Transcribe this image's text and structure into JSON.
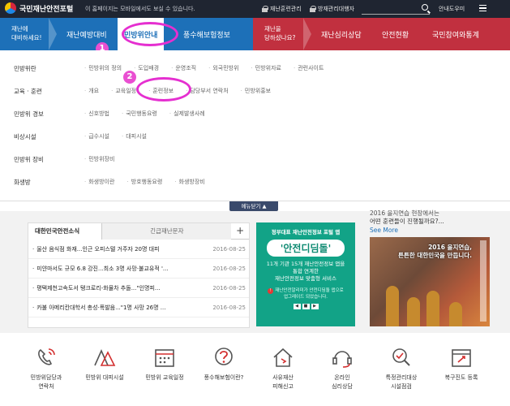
{
  "topbar": {
    "logo_text": "국민재난안전포털",
    "notice": "이 홈페이지는 모바일에서도 보실 수 있습니다.",
    "link1": "재난훈련관리",
    "link2": "방재관리대행자",
    "guide": "안내도우미",
    "search_placeholder": ""
  },
  "nav": {
    "left_label": "재난에\n대비하세요!",
    "blue_items": [
      "재난예방대비",
      "민방위안내",
      "풍수해보험정보"
    ],
    "right_label": "재난을\n당하셨나요?",
    "red_items": [
      "재난심리상담",
      "안전현황",
      "국민참여와통계"
    ],
    "active_index": 1
  },
  "megamenu": {
    "rows": [
      {
        "category": "민방위란",
        "links": [
          "민방위의 정의",
          "도입배경",
          "운영조직",
          "외국민방위",
          "민방위자료",
          "관련사이트"
        ]
      },
      {
        "category": "교육 · 훈련",
        "links": [
          "개요",
          "교육일정",
          "훈련정보",
          "담당부서 연락처",
          "민방위홍보"
        ]
      },
      {
        "category": "민방위 경보",
        "links": [
          "신호방법",
          "국민행동요령",
          "실제발생사례"
        ]
      },
      {
        "category": "비상시설",
        "links": [
          "급수시설",
          "대피시설"
        ]
      },
      {
        "category": "민방위 장비",
        "links": [
          "민방위장비"
        ]
      },
      {
        "category": "화생방",
        "links": [
          "화생방이란",
          "방호행동요령",
          "화생방장비"
        ]
      }
    ],
    "collapse_label": "메뉴닫기 ▲"
  },
  "badges": {
    "one": "1",
    "two": "2"
  },
  "news": {
    "tab_active": "대한민국안전소식",
    "tab_inactive": "긴급재난문자",
    "plus": "+",
    "items": [
      {
        "title": "울산 음식점 화재...인근 오피스텔 거주자 20명 대피",
        "date": "2016-08-25"
      },
      {
        "title": "미얀마서도 규모 6.8 강진...최소 3명 사망·불교유적 '...",
        "date": "2016-08-25"
      },
      {
        "title": "평택제천고속도서 탱크로리-화물차 추돌...\"인명피...",
        "date": "2016-08-25"
      },
      {
        "title": "카불 아메리칸대학서 총성·폭발음...\"1명 사망 26명 ...",
        "date": "2016-08-25"
      }
    ]
  },
  "promo": {
    "top": "정부대표 재난안전정보 포털 앱",
    "title": "'안전디딤돌'",
    "desc": "11개 기관 15개 재난안전정보 앱을\n통합 연계한\n재난안전정보 맞춤형 서비스",
    "note": "재난안전알리미가 안전디딤돌 앱으로\n업그레이드 되었습니다.",
    "pager": [
      "◀",
      "■",
      "▶"
    ]
  },
  "side": {
    "text": "어떤 훈련들이 진행될까요?...",
    "text_prev": "2016 을지연습 현장에서는",
    "see_more": "See More",
    "caption": "2016 을지연습,\n튼튼한 대한민국을 만듭니다."
  },
  "quick": [
    {
      "label": "민방위담당과\n연락처",
      "icon": "phone-icon"
    },
    {
      "label": "민방위 대피시설",
      "icon": "shelter-icon"
    },
    {
      "label": "민방위 교육일정",
      "icon": "calendar-icon"
    },
    {
      "label": "풍수해보험이란?",
      "icon": "question-icon"
    },
    {
      "label": "사유재산\n피해신고",
      "icon": "house-report-icon"
    },
    {
      "label": "온라인\n심리상담",
      "icon": "headset-icon"
    },
    {
      "label": "특정관리대상\n시설점검",
      "icon": "inspection-icon"
    },
    {
      "label": "복구진도 등록",
      "icon": "recovery-calendar-icon"
    }
  ],
  "colors": {
    "nav_blue": "#1d70b8",
    "nav_red": "#c1303f",
    "highlight": "#e52fd0",
    "promo_green": "#12a387",
    "topbar": "#1f2531"
  }
}
